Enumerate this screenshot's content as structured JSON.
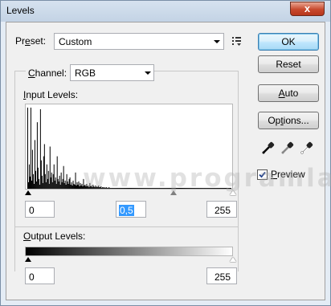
{
  "window": {
    "title": "Levels",
    "close_glyph": "x"
  },
  "preset": {
    "label_pre": "Pr",
    "label_u": "e",
    "label_post": "set:",
    "value": "Custom",
    "menu_icon": "preset-options-icon"
  },
  "channel": {
    "label_u": "C",
    "label_post": "hannel:",
    "value": "RGB"
  },
  "input_levels": {
    "label_u": "I",
    "label_post": "nput Levels:",
    "black": "0",
    "gamma": "0,5",
    "white": "255"
  },
  "output_levels": {
    "label_u": "O",
    "label_post": "utput Levels:",
    "black": "0",
    "white": "255"
  },
  "histogram": {
    "bars": [
      [
        0,
        100
      ],
      [
        1,
        8
      ],
      [
        2,
        30
      ],
      [
        3,
        15
      ],
      [
        4,
        100
      ],
      [
        5,
        10
      ],
      [
        6,
        48
      ],
      [
        7,
        18
      ],
      [
        8,
        6
      ],
      [
        9,
        60
      ],
      [
        10,
        22
      ],
      [
        11,
        9
      ],
      [
        12,
        82
      ],
      [
        13,
        26
      ],
      [
        14,
        12
      ],
      [
        15,
        5
      ],
      [
        16,
        98
      ],
      [
        17,
        35
      ],
      [
        18,
        16
      ],
      [
        19,
        7
      ],
      [
        20,
        40
      ],
      [
        21,
        55
      ],
      [
        22,
        18
      ],
      [
        23,
        8
      ],
      [
        24,
        30
      ],
      [
        25,
        12
      ],
      [
        26,
        22
      ],
      [
        27,
        6
      ],
      [
        28,
        52
      ],
      [
        29,
        14
      ],
      [
        30,
        20
      ],
      [
        31,
        8
      ],
      [
        32,
        18
      ],
      [
        33,
        30
      ],
      [
        34,
        10
      ],
      [
        35,
        14
      ],
      [
        36,
        6
      ],
      [
        37,
        40
      ],
      [
        38,
        12
      ],
      [
        39,
        9
      ],
      [
        40,
        16
      ],
      [
        41,
        5
      ],
      [
        42,
        20
      ],
      [
        43,
        8
      ],
      [
        44,
        12
      ],
      [
        45,
        28
      ],
      [
        46,
        7
      ],
      [
        47,
        10
      ],
      [
        48,
        5
      ],
      [
        49,
        18
      ],
      [
        50,
        9
      ],
      [
        51,
        6
      ],
      [
        52,
        12
      ],
      [
        53,
        14
      ],
      [
        54,
        5
      ],
      [
        55,
        8
      ],
      [
        56,
        4
      ],
      [
        57,
        10
      ],
      [
        58,
        6
      ],
      [
        59,
        5
      ],
      [
        60,
        20
      ],
      [
        61,
        4
      ],
      [
        62,
        8
      ],
      [
        63,
        5
      ],
      [
        64,
        9
      ],
      [
        65,
        3
      ],
      [
        66,
        7
      ],
      [
        67,
        4
      ],
      [
        68,
        6
      ],
      [
        69,
        3
      ],
      [
        70,
        12
      ],
      [
        71,
        4
      ],
      [
        72,
        5
      ],
      [
        73,
        3
      ],
      [
        74,
        6
      ],
      [
        75,
        3
      ],
      [
        76,
        4
      ],
      [
        77,
        2
      ],
      [
        78,
        7
      ],
      [
        79,
        3
      ],
      [
        80,
        4
      ],
      [
        81,
        2
      ],
      [
        82,
        5
      ],
      [
        83,
        3
      ],
      [
        84,
        2
      ],
      [
        85,
        4
      ],
      [
        86,
        2
      ],
      [
        87,
        3
      ],
      [
        88,
        2
      ],
      [
        89,
        4
      ],
      [
        90,
        2
      ],
      [
        91,
        2
      ],
      [
        92,
        3
      ],
      [
        93,
        1
      ],
      [
        94,
        2
      ],
      [
        95,
        2
      ],
      [
        96,
        1
      ],
      [
        97,
        2
      ],
      [
        98,
        1
      ],
      [
        99,
        2
      ],
      [
        100,
        1
      ],
      [
        101,
        1
      ],
      [
        102,
        2
      ],
      [
        103,
        1
      ],
      [
        104,
        1
      ],
      [
        105,
        1
      ],
      [
        106,
        1
      ],
      [
        107,
        1
      ],
      [
        108,
        1
      ],
      [
        109,
        1
      ],
      [
        110,
        1
      ],
      [
        111,
        1
      ],
      [
        112,
        1
      ],
      [
        113,
        1
      ],
      [
        114,
        1
      ],
      [
        115,
        1
      ],
      [
        116,
        1
      ],
      [
        117,
        1
      ],
      [
        118,
        1
      ],
      [
        119,
        1
      ],
      [
        120,
        1
      ],
      [
        121,
        1
      ],
      [
        122,
        1
      ],
      [
        123,
        1
      ],
      [
        124,
        1
      ],
      [
        125,
        1
      ],
      [
        126,
        1
      ],
      [
        127,
        1
      ],
      [
        128,
        1
      ],
      [
        129,
        1
      ],
      [
        130,
        1
      ],
      [
        131,
        1
      ],
      [
        132,
        1
      ],
      [
        133,
        1
      ],
      [
        134,
        1
      ],
      [
        135,
        1
      ],
      [
        136,
        1
      ],
      [
        137,
        1
      ],
      [
        138,
        1
      ],
      [
        139,
        1
      ],
      [
        140,
        1
      ],
      [
        141,
        1
      ],
      [
        142,
        1
      ],
      [
        143,
        1
      ],
      [
        144,
        1
      ],
      [
        145,
        1
      ],
      [
        146,
        1
      ],
      [
        147,
        1
      ],
      [
        148,
        1
      ],
      [
        149,
        1
      ],
      [
        150,
        1
      ],
      [
        151,
        1
      ],
      [
        152,
        1
      ],
      [
        153,
        1
      ],
      [
        154,
        1
      ],
      [
        155,
        1
      ],
      [
        156,
        1
      ],
      [
        157,
        1
      ],
      [
        158,
        1
      ],
      [
        159,
        1
      ],
      [
        160,
        1
      ],
      [
        161,
        1
      ],
      [
        162,
        1
      ],
      [
        163,
        1
      ],
      [
        164,
        1
      ],
      [
        165,
        1
      ],
      [
        166,
        1
      ],
      [
        167,
        1
      ],
      [
        168,
        1
      ],
      [
        169,
        1
      ],
      [
        170,
        1
      ],
      [
        171,
        1
      ],
      [
        172,
        1
      ],
      [
        173,
        1
      ],
      [
        174,
        1
      ],
      [
        175,
        1
      ],
      [
        176,
        1
      ],
      [
        177,
        1
      ],
      [
        178,
        1
      ],
      [
        179,
        1
      ],
      [
        180,
        1
      ],
      [
        181,
        1
      ],
      [
        182,
        1
      ],
      [
        183,
        1
      ],
      [
        184,
        1
      ],
      [
        185,
        1
      ],
      [
        186,
        1
      ],
      [
        187,
        1
      ],
      [
        188,
        1
      ],
      [
        189,
        1
      ],
      [
        190,
        1
      ],
      [
        191,
        1
      ],
      [
        192,
        1
      ],
      [
        193,
        1
      ],
      [
        194,
        1
      ],
      [
        195,
        1
      ],
      [
        196,
        1
      ],
      [
        197,
        1
      ],
      [
        198,
        1
      ],
      [
        199,
        1
      ],
      [
        200,
        1
      ],
      [
        201,
        1
      ],
      [
        202,
        1
      ],
      [
        203,
        1
      ],
      [
        204,
        1
      ],
      [
        205,
        1
      ],
      [
        206,
        1
      ],
      [
        207,
        1
      ],
      [
        208,
        1
      ],
      [
        209,
        1
      ],
      [
        210,
        1
      ],
      [
        211,
        1
      ],
      [
        212,
        1
      ],
      [
        213,
        1
      ],
      [
        214,
        1
      ],
      [
        215,
        1
      ],
      [
        216,
        1
      ],
      [
        217,
        1
      ],
      [
        218,
        1
      ],
      [
        219,
        1
      ],
      [
        220,
        1
      ],
      [
        221,
        1
      ],
      [
        222,
        1
      ],
      [
        223,
        1
      ],
      [
        224,
        1
      ],
      [
        225,
        1
      ],
      [
        226,
        1
      ],
      [
        227,
        1
      ],
      [
        228,
        1
      ],
      [
        229,
        1
      ],
      [
        230,
        1
      ],
      [
        231,
        1
      ],
      [
        232,
        1
      ],
      [
        233,
        1
      ],
      [
        234,
        1
      ],
      [
        235,
        1
      ],
      [
        236,
        1
      ],
      [
        237,
        1
      ],
      [
        238,
        1
      ],
      [
        239,
        1
      ],
      [
        240,
        1
      ],
      [
        241,
        1
      ],
      [
        242,
        1
      ],
      [
        243,
        1
      ],
      [
        244,
        1
      ],
      [
        245,
        1
      ],
      [
        246,
        1
      ],
      [
        247,
        1
      ],
      [
        248,
        1
      ],
      [
        249,
        1
      ],
      [
        250,
        1
      ],
      [
        251,
        1
      ],
      [
        252,
        1
      ],
      [
        253,
        1
      ],
      [
        254,
        1
      ],
      [
        255,
        1
      ]
    ],
    "max_level": 255
  },
  "slider_positions": {
    "input_black": 0,
    "input_gamma": 0.72,
    "input_white": 1,
    "output_black": 0,
    "output_white": 1
  },
  "buttons": {
    "ok": "OK",
    "reset": "Reset",
    "auto_u": "A",
    "auto_post": "uto",
    "options_pre": "Op",
    "options_u": "t",
    "options_post": "ions..."
  },
  "eyedroppers": [
    "black-point-eyedropper-icon",
    "gray-point-eyedropper-icon",
    "white-point-eyedropper-icon"
  ],
  "preview": {
    "label_u": "P",
    "label_post": "review",
    "checked": true
  },
  "watermark": "www.programlar.com"
}
